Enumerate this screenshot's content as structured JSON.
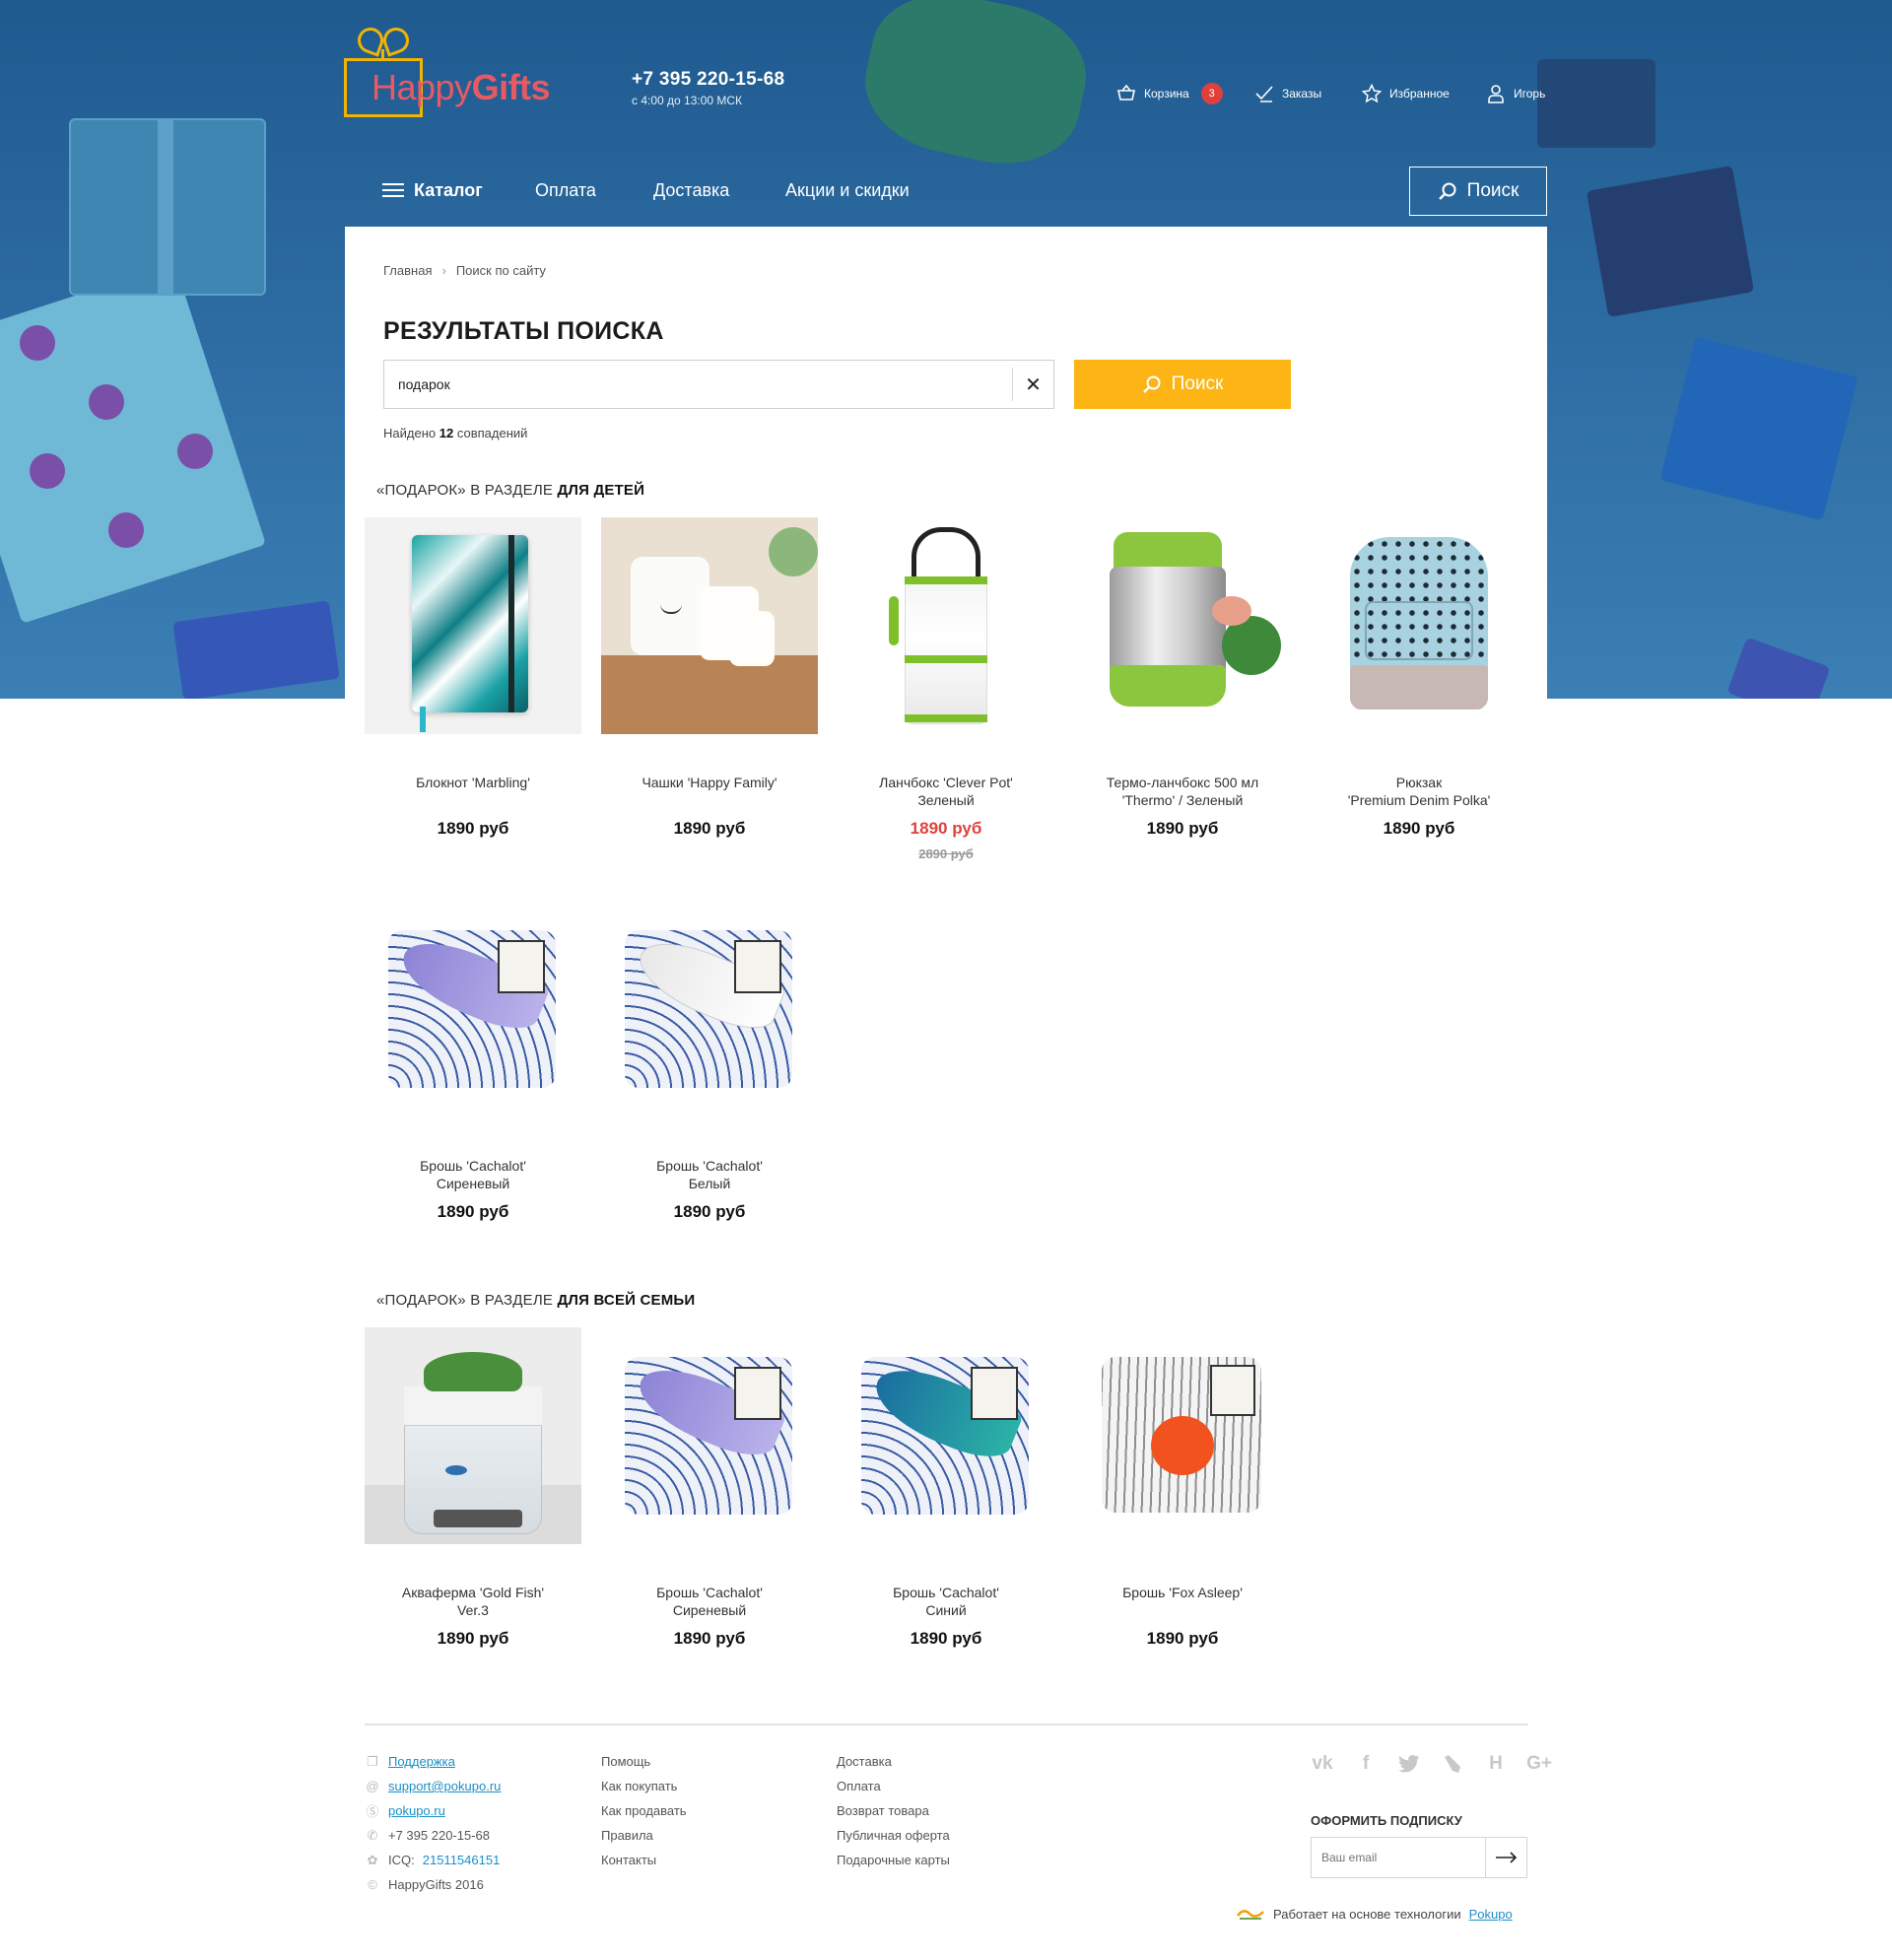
{
  "brand": {
    "logo_part1": "Happy",
    "logo_part2": "Gifts"
  },
  "header": {
    "phone": "+7 395 220-15-68",
    "hours": "с 4:00 до 13:00 МСК",
    "cart_label": "Корзина",
    "cart_count": "3",
    "orders_label": "Заказы",
    "favorites_label": "Избранное",
    "user_label": "Игорь"
  },
  "nav": {
    "catalog": "Каталог",
    "items": [
      "Оплата",
      "Доставка",
      "Акции и скидки"
    ],
    "search": "Поиск"
  },
  "breadcrumbs": [
    "Главная",
    "Поиск по сайту"
  ],
  "page_title": "РЕЗУЛЬТАТЫ ПОИСКА",
  "search": {
    "query": "подарок",
    "button": "Поиск",
    "found_prefix": "Найдено",
    "found_count": "12",
    "found_suffix": "совпадений"
  },
  "sections": [
    {
      "prefix": "«ПОДАРОК» В РАЗДЕЛЕ",
      "name": "ДЛЯ ДЕТЕЙ",
      "products": [
        {
          "name1": "Блокнот 'Marbling'",
          "name2": "",
          "price": "1890 руб",
          "old_price": "",
          "icon": "notebook-image"
        },
        {
          "name1": "Чашки 'Happy Family'",
          "name2": "",
          "price": "1890 руб",
          "old_price": "",
          "icon": "cups-image"
        },
        {
          "name1": "Ланчбокс 'Clever Pot'",
          "name2": "Зеленый",
          "price": "1890 руб",
          "old_price": "2890 руб",
          "icon": "lunchbox-image"
        },
        {
          "name1": "Термо-ланчбокс 500 мл",
          "name2": "'Thermo' / Зеленый",
          "price": "1890 руб",
          "old_price": "",
          "icon": "thermo-image"
        },
        {
          "name1": "Рюкзак",
          "name2": "'Premium Denim Polka'",
          "price": "1890 руб",
          "old_price": "",
          "icon": "backpack-image"
        },
        {
          "name1": "Брошь 'Cachalot'",
          "name2": "Сиреневый",
          "price": "1890 руб",
          "old_price": "",
          "icon": "brooch-lilac-image"
        },
        {
          "name1": "Брошь 'Cachalot'",
          "name2": "Белый",
          "price": "1890 руб",
          "old_price": "",
          "icon": "brooch-white-image"
        }
      ]
    },
    {
      "prefix": "«ПОДАРОК» В РАЗДЕЛЕ",
      "name": "ДЛЯ ВСЕЙ СЕМЬИ",
      "products": [
        {
          "name1": "Акваферма 'Gold Fish'",
          "name2": "Ver.3",
          "price": "1890 руб",
          "old_price": "",
          "icon": "aquafarm-image"
        },
        {
          "name1": "Брошь 'Cachalot'",
          "name2": "Сиреневый",
          "price": "1890 руб",
          "old_price": "",
          "icon": "brooch-lilac-image"
        },
        {
          "name1": "Брошь 'Cachalot'",
          "name2": "Синий",
          "price": "1890 руб",
          "old_price": "",
          "icon": "brooch-blue-image"
        },
        {
          "name1": "Брошь 'Fox Asleep'",
          "name2": "",
          "price": "1890 руб",
          "old_price": "",
          "icon": "brooch-fox-image"
        }
      ]
    }
  ],
  "footer": {
    "contacts": {
      "support": "Поддержка",
      "email": "support@pokupo.ru",
      "skype": "pokupo.ru",
      "phone": "+7 395 220-15-68",
      "icq_label": "ICQ:",
      "icq": "21511546151",
      "copyright": "HappyGifts 2016"
    },
    "col2": [
      "Помощь",
      "Как покупать",
      "Как продавать",
      "Правила",
      "Контакты"
    ],
    "col3": [
      "Доставка",
      "Оплата",
      "Возврат товара",
      "Публичная оферта",
      "Подарочные карты"
    ],
    "socials": [
      "vk-icon",
      "facebook-icon",
      "twitter-icon",
      "livejournal-icon",
      "habr-icon",
      "google-plus-icon"
    ],
    "subscribe_title": "ОФОРМИТЬ ПОДПИСКУ",
    "subscribe_placeholder": "Ваш email",
    "powered_text": "Работает на основе технологии",
    "powered_link": "Pokupo"
  },
  "colors": {
    "accent": "#fcb514",
    "sale": "#e0403c",
    "link": "#1a8fc8",
    "hero": "#2f6fa6"
  }
}
